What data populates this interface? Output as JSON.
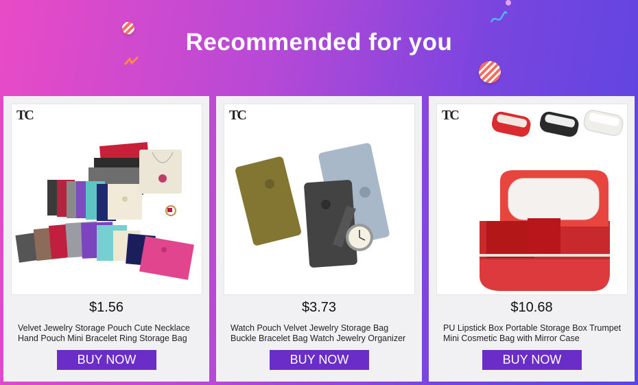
{
  "header": {
    "title": "Recommended for you"
  },
  "products": [
    {
      "brand": "TC",
      "price": "$1.56",
      "description": "Velvet Jewelry Storage Pouch Cute Necklace Hand Pouch Mini Bracelet Ring Storage Bag",
      "buy_label": "BUY NOW"
    },
    {
      "brand": "TC",
      "price": "$3.73",
      "description": "Watch Pouch Velvet Jewelry Storage Bag Buckle Bracelet Bag Watch Jewelry Organizer",
      "buy_label": "BUY NOW"
    },
    {
      "brand": "TC",
      "price": "$10.68",
      "description": "PU Lipstick Box Portable Storage Box Trumpet Mini Cosmetic Bag with Mirror Case",
      "buy_label": "BUY NOW"
    }
  ],
  "colors": {
    "accent": "#6a2dc8",
    "card_bg": "#f1f1f4"
  }
}
